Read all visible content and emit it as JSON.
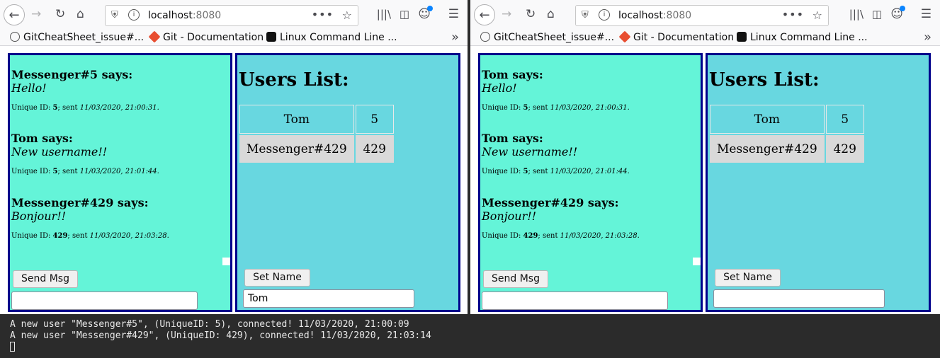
{
  "browser": {
    "host": "localhost",
    "port": ":8080",
    "bookmarks": [
      "GitCheatSheet_issue#...",
      "Git - Documentation",
      "Linux Command Line ..."
    ]
  },
  "windows": [
    {
      "messages": [
        {
          "who": "Messenger#5 says:",
          "text": "Hello!",
          "id": "5",
          "sent": "11/03/2020, 21:00:31."
        },
        {
          "who": "Tom says:",
          "text": "New username!!",
          "id": "5",
          "sent": "11/03/2020, 21:01:44."
        },
        {
          "who": "Messenger#429 says:",
          "text": "Bonjour!!",
          "id": "429",
          "sent": "11/03/2020, 21:03:28."
        }
      ],
      "send_label": "Send Msg",
      "msg_input_value": "",
      "users_title": "Users List:",
      "users": [
        {
          "name": "Tom",
          "id": "5"
        },
        {
          "name": "Messenger#429",
          "id": "429"
        }
      ],
      "setname_label": "Set Name",
      "name_input_value": "Tom"
    },
    {
      "messages": [
        {
          "who": "Tom says:",
          "text": "Hello!",
          "id": "5",
          "sent": "11/03/2020, 21:00:31."
        },
        {
          "who": "Tom says:",
          "text": "New username!!",
          "id": "5",
          "sent": "11/03/2020, 21:01:44."
        },
        {
          "who": "Messenger#429 says:",
          "text": "Bonjour!!",
          "id": "429",
          "sent": "11/03/2020, 21:03:28."
        }
      ],
      "send_label": "Send Msg",
      "msg_input_value": "",
      "users_title": "Users List:",
      "users": [
        {
          "name": "Tom",
          "id": "5"
        },
        {
          "name": "Messenger#429",
          "id": "429"
        }
      ],
      "setname_label": "Set Name",
      "name_input_value": ""
    }
  ],
  "meta_labels": {
    "unique": "Unique ID: ",
    "sent": "; sent "
  },
  "terminal": {
    "lines": [
      "A new user \"Messenger#5\", (UniqueID: 5), connected! 11/03/2020, 21:00:09",
      "A new user \"Messenger#429\", (UniqueID: 429), connected! 11/03/2020, 21:03:14"
    ]
  },
  "colors": {
    "chat_bg": "#64f4d8",
    "users_bg": "#68d7e0",
    "panel_border": "#00008b",
    "terminal_bg": "#2b2b2b"
  }
}
